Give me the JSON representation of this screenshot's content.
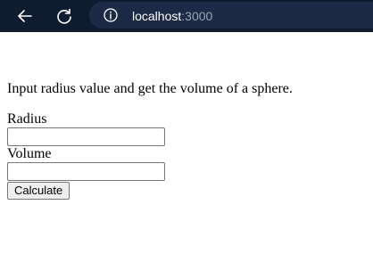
{
  "browser": {
    "url_host": "localhost",
    "url_port": ":3000"
  },
  "page": {
    "intro_text": "Input radius value and get the volume of a sphere.",
    "radius_label": "Radius",
    "radius_value": "",
    "volume_label": "Volume",
    "volume_value": "",
    "calculate_label": "Calculate"
  },
  "icons": {
    "back": "back-arrow-icon",
    "refresh": "refresh-icon",
    "info": "info-icon"
  }
}
